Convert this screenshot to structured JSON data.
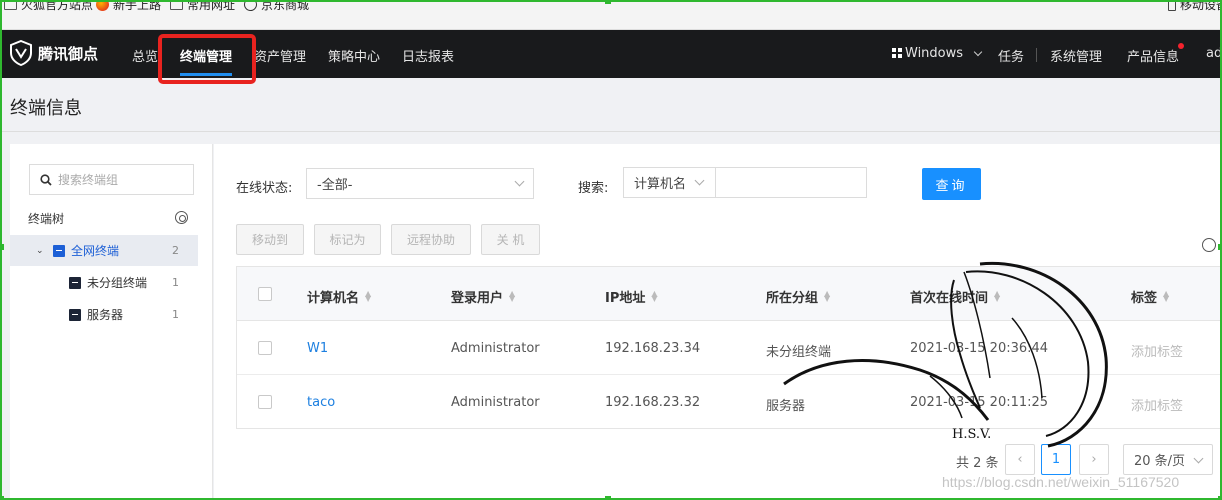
{
  "bookmarks": [
    {
      "label": "火狐官方站点",
      "icon": "folder-icon"
    },
    {
      "label": "新手上路",
      "icon": "firefox-icon"
    },
    {
      "label": "常用网址",
      "icon": "folder-icon"
    },
    {
      "label": "京东商城",
      "icon": "globe-icon"
    },
    {
      "label": "移动设备",
      "icon": "mobile-icon"
    }
  ],
  "nav": {
    "brand": "腾讯御点",
    "items": [
      "总览",
      "终端管理",
      "资产管理",
      "策略中心",
      "日志报表"
    ],
    "active": "终端管理",
    "os_select": "Windows",
    "right_items": [
      "任务",
      "系统管理",
      "产品信息",
      "ad"
    ]
  },
  "page": {
    "title": "终端信息"
  },
  "tree": {
    "search_placeholder": "搜索终端组",
    "title": "终端树",
    "nodes": [
      {
        "label": "全网终端",
        "count": "2",
        "selected": true
      },
      {
        "label": "未分组终端",
        "count": "1"
      },
      {
        "label": "服务器",
        "count": "1"
      }
    ]
  },
  "filters": {
    "online_label": "在线状态:",
    "online_value": "-全部-",
    "search_label": "搜索:",
    "search_field": "计算机名",
    "search_value": "",
    "query_button": "查询"
  },
  "actions": [
    "移动到",
    "标记为",
    "远程协助",
    "关 机"
  ],
  "table": {
    "columns": [
      "计算机名",
      "登录用户",
      "IP地址",
      "所在分组",
      "首次在线时间",
      "标签"
    ],
    "rows": [
      {
        "name": "W1",
        "user": "Administrator",
        "ip": "192.168.23.34",
        "group": "未分组终端",
        "first_online": "2021-03-15 20:36:44",
        "tag": "添加标签"
      },
      {
        "name": "taco",
        "user": "Administrator",
        "ip": "192.168.23.32",
        "group": "服务器",
        "first_online": "2021-03-15 20:11:25",
        "tag": "添加标签"
      }
    ]
  },
  "pagination": {
    "total": "共 2 条",
    "current_page": "1",
    "page_size": "20 条/页"
  },
  "watermark": "https://blog.csdn.net/weixin_51167520",
  "colors": {
    "accent": "#1890ff",
    "nav_bg": "#191a1c",
    "highlight": "#e8231f",
    "frame": "#2fb82f"
  }
}
